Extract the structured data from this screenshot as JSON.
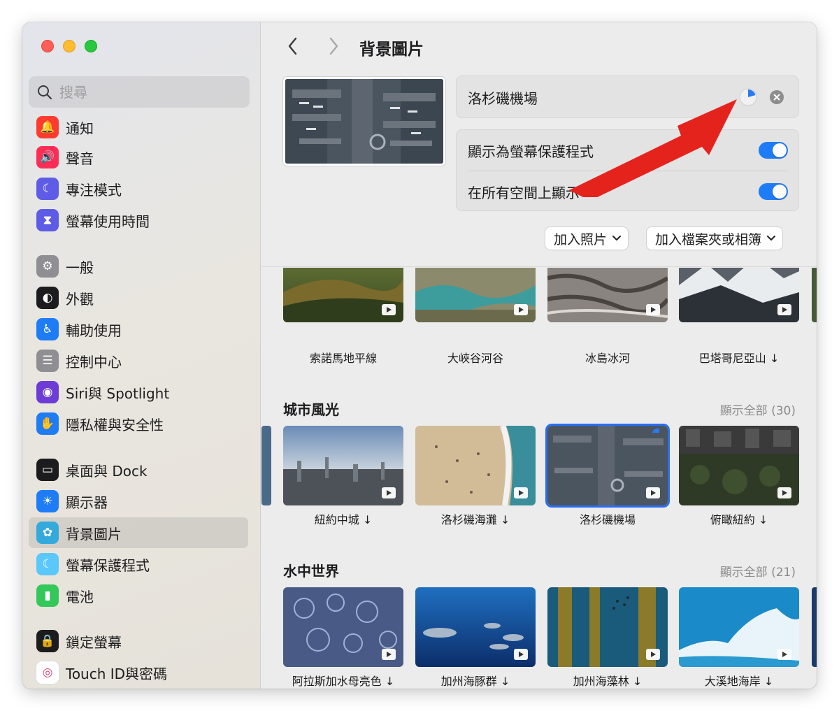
{
  "sidebar": {
    "search_placeholder": "搜尋",
    "items": [
      {
        "label": "通知",
        "icon": "bell-icon",
        "color": "#ff3b30"
      },
      {
        "label": "聲音",
        "icon": "speaker-icon",
        "color": "#ff2d55"
      },
      {
        "label": "專注模式",
        "icon": "moon-icon",
        "color": "#5e5ce6"
      },
      {
        "label": "螢幕使用時間",
        "icon": "hourglass-icon",
        "color": "#5e5ce6"
      },
      {
        "label": "一般",
        "icon": "gear-icon",
        "color": "#8e8e93"
      },
      {
        "label": "外觀",
        "icon": "appearance-icon",
        "color": "#1c1c1e"
      },
      {
        "label": "輔助使用",
        "icon": "accessibility-icon",
        "color": "#1e7cf7"
      },
      {
        "label": "控制中心",
        "icon": "control-center-icon",
        "color": "#8e8e93"
      },
      {
        "label": "Siri與 Spotlight",
        "icon": "siri-icon",
        "color": "#6d3cd6"
      },
      {
        "label": "隱私權與安全性",
        "icon": "hand-icon",
        "color": "#1e7cf7"
      },
      {
        "label": "桌面與 Dock",
        "icon": "dock-icon",
        "color": "#1c1c1e"
      },
      {
        "label": "顯示器",
        "icon": "sun-icon",
        "color": "#1e7cf7"
      },
      {
        "label": "背景圖片",
        "icon": "flower-icon",
        "color": "#34aadc"
      },
      {
        "label": "螢幕保護程式",
        "icon": "screensaver-icon",
        "color": "#5ac8fa"
      },
      {
        "label": "電池",
        "icon": "battery-icon",
        "color": "#34c759"
      },
      {
        "label": "鎖定螢幕",
        "icon": "lock-icon",
        "color": "#1c1c1e"
      },
      {
        "label": "Touch ID與密碼",
        "icon": "fingerprint-icon",
        "color": "#ffffff"
      }
    ],
    "active_index": 12
  },
  "header": {
    "title": "背景圖片"
  },
  "current": {
    "name": "洛杉磯機場",
    "show_as_screensaver_label": "顯示為螢幕保護程式",
    "show_as_screensaver": true,
    "show_all_spaces_label": "在所有空間上顯示",
    "show_all_spaces": true
  },
  "actions": {
    "add_photo": "加入照片",
    "add_folder": "加入檔案夾或相簿"
  },
  "sections": {
    "landscape": {
      "items": [
        {
          "label": "索諾馬地平線"
        },
        {
          "label": "大峽谷河谷"
        },
        {
          "label": "冰島冰河"
        },
        {
          "label": "巴塔哥尼亞山 ↓"
        }
      ]
    },
    "city": {
      "title": "城市風光",
      "show_all": "顯示全部 (30)",
      "items": [
        {
          "label": "紐約中城 ↓"
        },
        {
          "label": "洛杉磯海灘 ↓"
        },
        {
          "label": "洛杉磯機場"
        },
        {
          "label": "俯瞰紐約 ↓"
        }
      ]
    },
    "underwater": {
      "title": "水中世界",
      "show_all": "顯示全部 (21)",
      "items": [
        {
          "label": "阿拉斯加水母亮色 ↓"
        },
        {
          "label": "加州海豚群 ↓"
        },
        {
          "label": "加州海藻林 ↓"
        },
        {
          "label": "大溪地海岸 ↓"
        }
      ]
    }
  }
}
